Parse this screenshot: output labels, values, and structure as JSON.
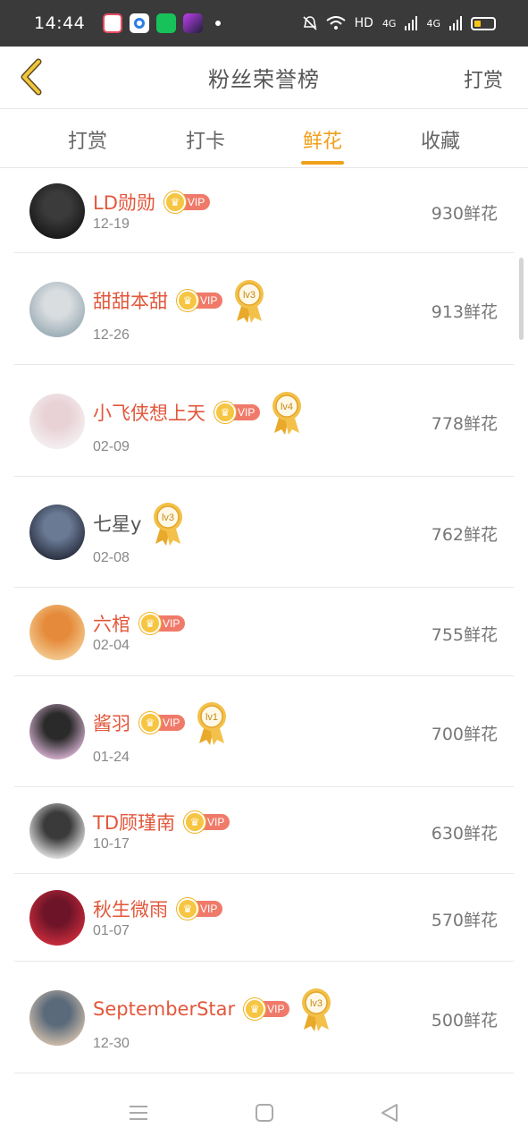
{
  "status_bar": {
    "time": "14:44",
    "network_label": "HD",
    "signal_1": "4G",
    "signal_2": "4G"
  },
  "header": {
    "title": "粉丝荣誉榜",
    "action_label": "打赏"
  },
  "tabs": [
    {
      "label": "打赏",
      "active": false
    },
    {
      "label": "打卡",
      "active": false
    },
    {
      "label": "鲜花",
      "active": true
    },
    {
      "label": "收藏",
      "active": false
    }
  ],
  "vip_label": "VIP",
  "colors": {
    "accent": "#f0a01c",
    "name_red": "#e2573b",
    "vip_bg": "#f07a6a"
  },
  "fans": [
    {
      "name": "LD勋勋",
      "vip": true,
      "level": "",
      "date": "12-19",
      "amount": "930鲜花"
    },
    {
      "name": "甜甜本甜",
      "vip": true,
      "level": "lv3",
      "date": "12-26",
      "amount": "913鲜花"
    },
    {
      "name": "小飞侠想上天",
      "vip": true,
      "level": "lv4",
      "date": "02-09",
      "amount": "778鲜花"
    },
    {
      "name": "七星y",
      "vip": false,
      "level": "lv3",
      "date": "02-08",
      "amount": "762鲜花"
    },
    {
      "name": "六棺",
      "vip": true,
      "level": "",
      "date": "02-04",
      "amount": "755鲜花"
    },
    {
      "name": "酱羽",
      "vip": true,
      "level": "lv1",
      "date": "01-24",
      "amount": "700鲜花"
    },
    {
      "name": "TD顾瑾南",
      "vip": true,
      "level": "",
      "date": "10-17",
      "amount": "630鲜花"
    },
    {
      "name": "秋生微雨",
      "vip": true,
      "level": "",
      "date": "01-07",
      "amount": "570鲜花"
    },
    {
      "name": "SeptemberStar",
      "vip": true,
      "level": "lv3",
      "date": "12-30",
      "amount": "500鲜花"
    }
  ],
  "icons": {
    "back": "chevron-left-icon",
    "nav_menu": "menu-icon",
    "nav_home": "square-icon",
    "nav_back": "triangle-back-icon"
  }
}
